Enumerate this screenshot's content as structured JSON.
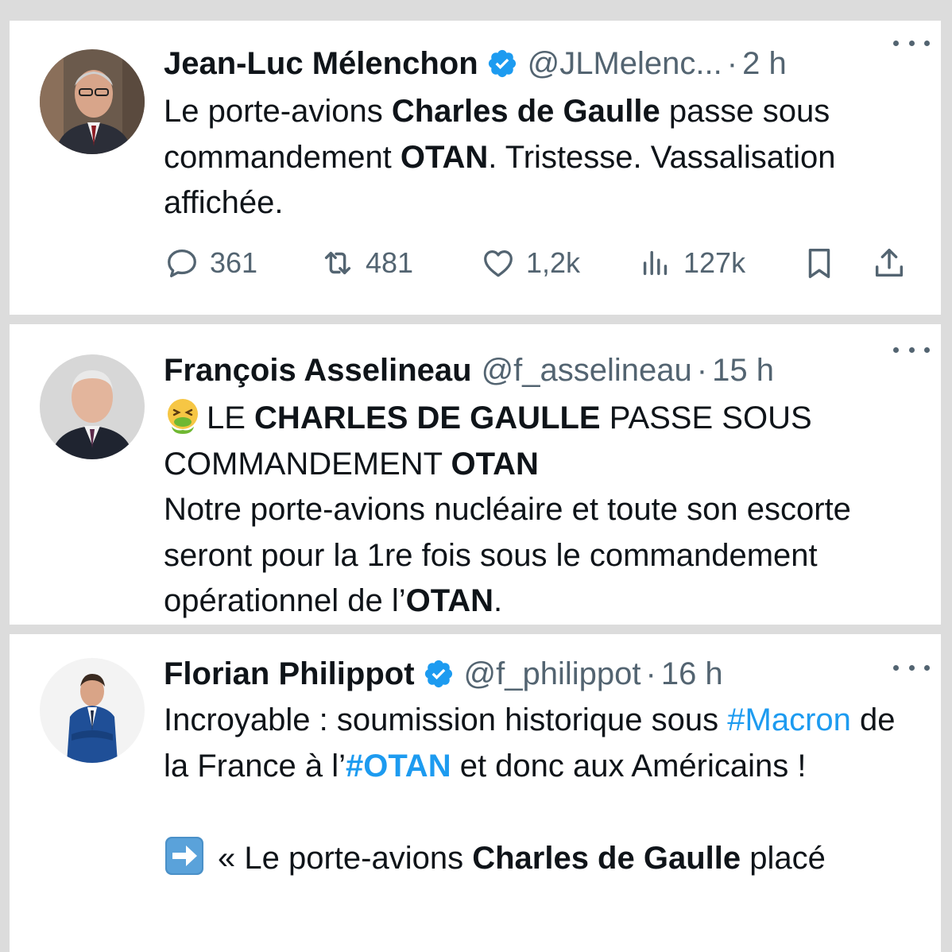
{
  "tweets": [
    {
      "name": "Jean-Luc Mélenchon",
      "handle": "@JLMelenc...",
      "dot": "·",
      "time": "2 h",
      "text": {
        "p1": "Le porte-avions ",
        "b1": "Charles de Gaulle",
        "p2": " passe sous commandement ",
        "b2": "OTAN",
        "p3": ". Tristesse. Vassalisation affichée."
      },
      "stats": {
        "replies": "361",
        "retweets": "481",
        "likes": "1,2k",
        "views": "127k"
      }
    },
    {
      "name": "François Asselineau",
      "handle": "@f_asselineau",
      "dot": "·",
      "time": "15 h",
      "text": {
        "p1": "LE ",
        "b1": "CHARLES DE GAULLE",
        "p2": " PASSE SOUS COMMANDEMENT ",
        "b2": "OTAN",
        "p3": "Notre porte-avions nucléaire et toute son escorte seront pour la 1re fois sous le commandement opérationnel de l’",
        "b3": "OTAN",
        "p4": "."
      }
    },
    {
      "name": "Florian Philippot",
      "handle": "@f_philippot",
      "dot": "·",
      "time": "16 h",
      "text": {
        "p1": "Incroyable : soumission historique sous ",
        "tag1": "#Macron",
        "p2": " de la France à l’",
        "tag2": "#OTAN",
        "p3": " et donc aux Américains !",
        "q1": "« Le porte-avions ",
        "b1": "Charles de Gaulle",
        "q2": " placé"
      }
    }
  ],
  "icons": {
    "verified": "verified-badge-icon",
    "more": "more-options-icon",
    "reply": "reply-bubble-icon",
    "retweet": "retweet-icon",
    "like": "heart-icon",
    "views": "views-bar-chart-icon",
    "bookmark": "bookmark-icon",
    "share": "share-upload-icon",
    "vomit_emoji": "face-vomiting-emoji",
    "arrow_emoji": "right-arrow-emoji"
  },
  "colors": {
    "link": "#1d9bf0",
    "secondary": "#536471",
    "primary_text": "#0f1419",
    "verified": "#1d9bf0"
  }
}
